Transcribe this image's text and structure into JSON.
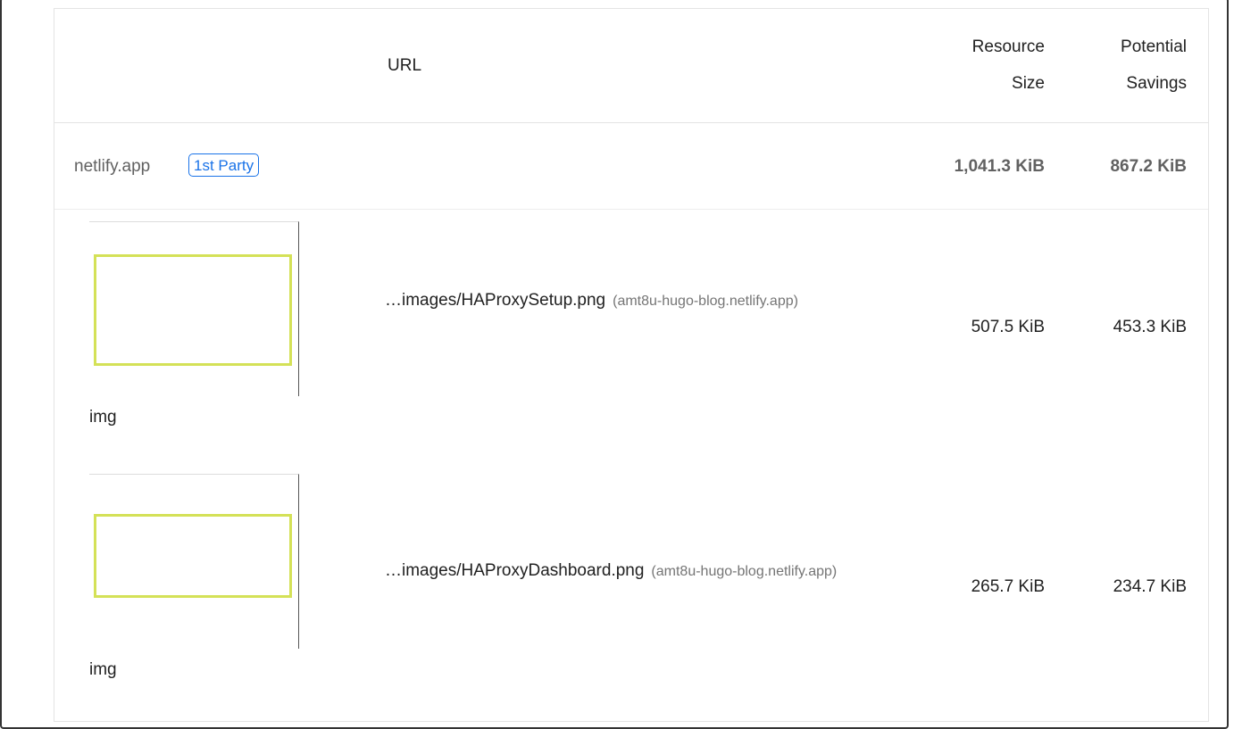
{
  "table": {
    "headers": {
      "url": "URL",
      "resource_size": [
        "Resource",
        "Size"
      ],
      "potential_savings": [
        "Potential",
        "Savings"
      ]
    },
    "group": {
      "name": "netlify.app",
      "badge": "1st Party",
      "resource_size": "1,041.3 KiB",
      "potential_savings": "867.2 KiB"
    },
    "rows": [
      {
        "node_label": "img",
        "url": "…images/HAProxySetup.png",
        "host": "(amt8u-hugo-blog.netlify.app)",
        "resource_size": "507.5 KiB",
        "potential_savings": "453.3 KiB"
      },
      {
        "node_label": "img",
        "url": "…images/HAProxyDashboard.png",
        "host": "(amt8u-hugo-blog.netlify.app)",
        "resource_size": "265.7 KiB",
        "potential_savings": "234.7 KiB"
      }
    ]
  },
  "colors": {
    "badge": "#1a73e8",
    "thumbnail_outline": "#d4e157",
    "border": "#e4e4e4"
  }
}
